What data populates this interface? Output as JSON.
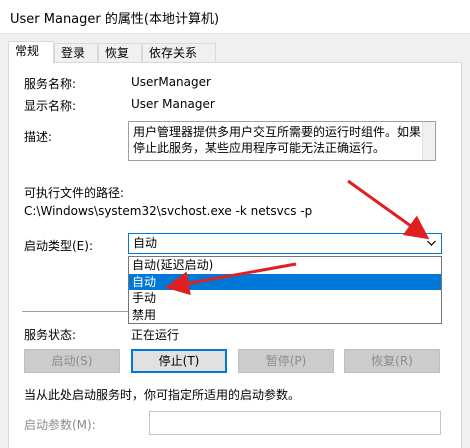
{
  "window": {
    "title": "User Manager 的属性(本地计算机)"
  },
  "tabs": [
    {
      "label": "常规",
      "active": true
    },
    {
      "label": "登录",
      "active": false
    },
    {
      "label": "恢复",
      "active": false
    },
    {
      "label": "依存关系",
      "active": false
    }
  ],
  "general": {
    "service_name_label": "服务名称:",
    "service_name_value": "UserManager",
    "display_name_label": "显示名称:",
    "display_name_value": "User Manager",
    "description_label": "描述:",
    "description_line1": "用户管理器提供多用户交互所需要的运行时组件。如果",
    "description_line2": "停止此服务，某些应用程序可能无法正确运行。",
    "exe_path_label": "可执行文件的路径:",
    "exe_path_value": "C:\\Windows\\system32\\svchost.exe -k netsvcs -p",
    "startup_type_label": "启动类型(E):",
    "startup_type_value": "自动",
    "startup_options": [
      "自动(延迟启动)",
      "自动",
      "手动",
      "禁用"
    ],
    "service_status_label": "服务状态:",
    "service_status_value": "正在运行"
  },
  "buttons": {
    "start": "启动(S)",
    "stop": "停止(T)",
    "pause": "暂停(P)",
    "resume": "恢复(R)"
  },
  "hint": "当从此处启动服务时，你可指定所适用的启动参数。",
  "start_params_label": "启动参数(M):",
  "colors": {
    "accent": "#0078d7",
    "arrow": "#e02020"
  }
}
